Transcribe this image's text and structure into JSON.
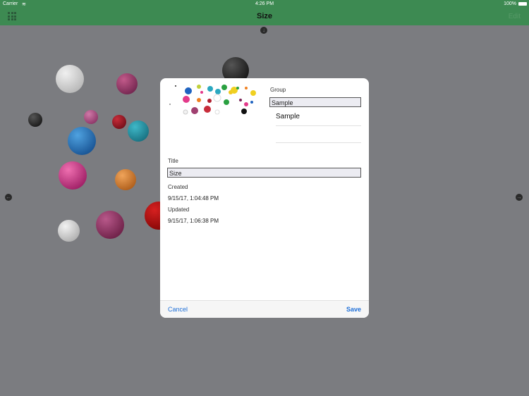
{
  "status_bar": {
    "carrier": "Carrier",
    "time": "4:26 PM",
    "battery": "100%",
    "wifi_icon": "wifi-icon",
    "battery_icon": "battery-icon"
  },
  "nav": {
    "title": "Size",
    "edit_label": "Edit",
    "menu_icon": "grid-icon"
  },
  "modal": {
    "group_label": "Group",
    "group_value": "Sample",
    "group_option": "Sample",
    "title_label": "Title",
    "title_value": "Size",
    "created_label": "Created",
    "created_value": "9/15/17, 1:04:48 PM",
    "updated_label": "Updated",
    "updated_value": "9/15/17, 1:06:38 PM",
    "cancel_label": "Cancel",
    "save_label": "Save"
  },
  "colors": {
    "accent": "#3d8a52",
    "link": "#1e6fd8",
    "backdrop": "#7b7c80"
  }
}
